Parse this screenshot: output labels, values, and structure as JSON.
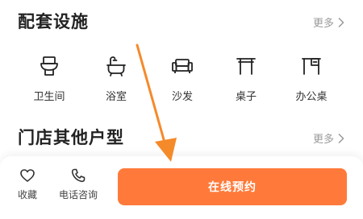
{
  "facilities": {
    "title": "配套设施",
    "more_label": "更多",
    "items": [
      {
        "label": "卫生间",
        "icon": "toilet-icon"
      },
      {
        "label": "浴室",
        "icon": "bathtub-icon"
      },
      {
        "label": "沙发",
        "icon": "sofa-icon"
      },
      {
        "label": "桌子",
        "icon": "table-icon"
      },
      {
        "label": "办公桌",
        "icon": "desk-icon"
      }
    ]
  },
  "other_types": {
    "title": "门店其他户型",
    "more_label": "更多"
  },
  "bottom_bar": {
    "favorite_label": "收藏",
    "phone_label": "电话咨询",
    "book_label": "在线预约"
  },
  "colors": {
    "accent": "#ff7a3a",
    "annotation_arrow": "#f58a2a",
    "muted_text": "#9a9a9a"
  }
}
